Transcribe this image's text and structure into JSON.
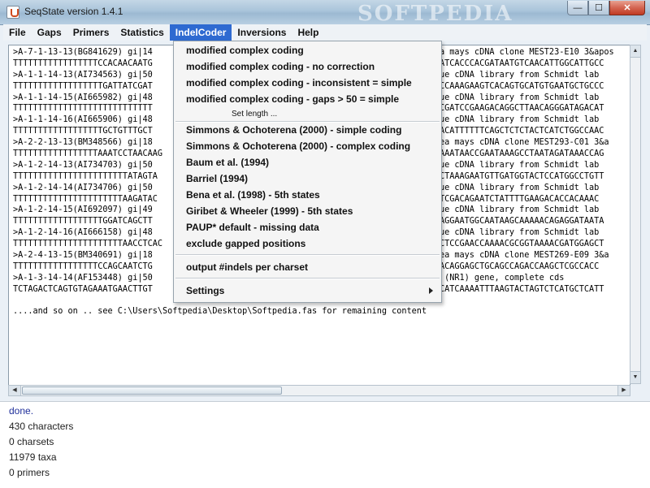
{
  "window": {
    "title": "SeqState version 1.4.1",
    "watermark": "SOFTPEDIA",
    "controls": {
      "minimize": "—",
      "maximize": "☐",
      "close": "✕"
    }
  },
  "menubar": [
    "File",
    "Gaps",
    "Primers",
    "Statistics",
    "IndelCoder",
    "Inversions",
    "Help"
  ],
  "active_menu": "IndelCoder",
  "indelcoder_menu": {
    "items_group1": [
      "modified complex coding",
      "modified complex coding - no correction",
      "modified complex coding - inconsistent = simple",
      "modified complex coding - gaps > 50 = simple"
    ],
    "set_length": "Set length ...",
    "items_group2": [
      "Simmons & Ochoterena (2000) - simple coding",
      "Simmons & Ochoterena (2000) - complex coding",
      "Baum et al. (1994)",
      "Barriel (1994)",
      "Bena et al. (1998) - 5th states",
      "Giribet & Wheeler (1999) - 5th states",
      "PAUP* default - missing data",
      "exclude gapped positions"
    ],
    "output_item": "output #indels per charset",
    "settings_item": "Settings"
  },
  "sequence_lines": [
    ">A-7-1-13-13(BG841629) gi|14",
    "TTTTTTTTTTTTTTTTTCCACAACAATG",
    ">A-1-1-14-13(AI734563) gi|50",
    "TTTTTTTTTTTTTTTTTTGATTATCGAT",
    ">A-1-1-14-15(AI665982) gi|48",
    "TTTTTTTTTTTTTTTTTTTTTTTTTTTT",
    ">A-1-1-14-16(AI665906) gi|48",
    "TTTTTTTTTTTTTTTTTTGCTGTTTGCT",
    ">A-2-2-13-13(BM348566) gi|18",
    "TTTTTTTTTTTTTTTTTAAATCCTAACAAG",
    ">A-1-2-14-13(AI734703) gi|50",
    "TTTTTTTTTTTTTTTTTTTTTTTATAGTA",
    ">A-1-2-14-14(AI734706) gi|50",
    "TTTTTTTTTTTTTTTTTTTTTTAAGATAC",
    ">A-1-2-14-15(AI692097) gi|49",
    "TTTTTTTTTTTTTTTTTTGGATCAGCTT",
    ">A-1-2-14-16(AI666158) gi|48",
    "TTTTTTTTTTTTTTTTTTTTTTAACCTCAC",
    ">A-2-4-13-15(BM340691) gi|18",
    "TTTTTTTTTTTTTTTTTCCAGCAATCTG",
    ">A-1-3-14-14(AF153448) gi|50",
    "TCTAGACTCAGTGTAGAAATGAACTTGT"
  ],
  "sequence_tails": [
    "a mays cDNA clone MEST23-E10 3&apos",
    "ATCACCCACGATAATGTCAACATTGGCATTGCC",
    "ue cDNA library from Schmidt lab",
    "CCAAAGAAGTCACAGTGCATGTGAATGCTGCCC",
    "ue cDNA library from Schmidt lab",
    "CGATCCGAAGACAGGCTTAACAGGGATAGACAT",
    "ue cDNA library from Schmidt lab",
    "ACATTTTTTCAGCTCTCTACTCATCTGGCCAAC",
    "ea mays cDNA clone MEST293-C01 3&a",
    "AAATAACCGAATAAAGCCTAATAGATAAACCAG",
    "ue cDNA library from Schmidt lab",
    "CTAAAGAATGTTGATGGTACTCCATGGCCTGTT",
    "ue cDNA library from Schmidt lab",
    "TCGACAGAATCTATTTTGAAGACACCACAAAC",
    "ue cDNA library from Schmidt lab",
    "AGGAATGGCAATAAGCAAAAACAGAGGATAATA",
    "ue cDNA library from Schmidt lab",
    "CTCCGAACCAAAACGCGGTAAAACGATGGAGCT",
    "ea mays cDNA clone MEST269-E09 3&a",
    "ACAGGAGCTGCAGCCAGACCAAGCTCGCCACC",
    " (NR1) gene, complete cds",
    "CATCAAAATTTAAGTACTAGTCTCATGCTCATT"
  ],
  "remaining_note": "....and so on .. see C:\\Users\\Softpedia\\Desktop\\Softpedia.fas for remaining content",
  "status": {
    "done": "done.",
    "characters": "430  characters",
    "charsets": "0  charsets",
    "taxa": "11979  taxa",
    "primers": "0  primers"
  },
  "colors": {
    "menu_highlight": "#2e6ad1",
    "status_done": "#1f2f9a"
  }
}
